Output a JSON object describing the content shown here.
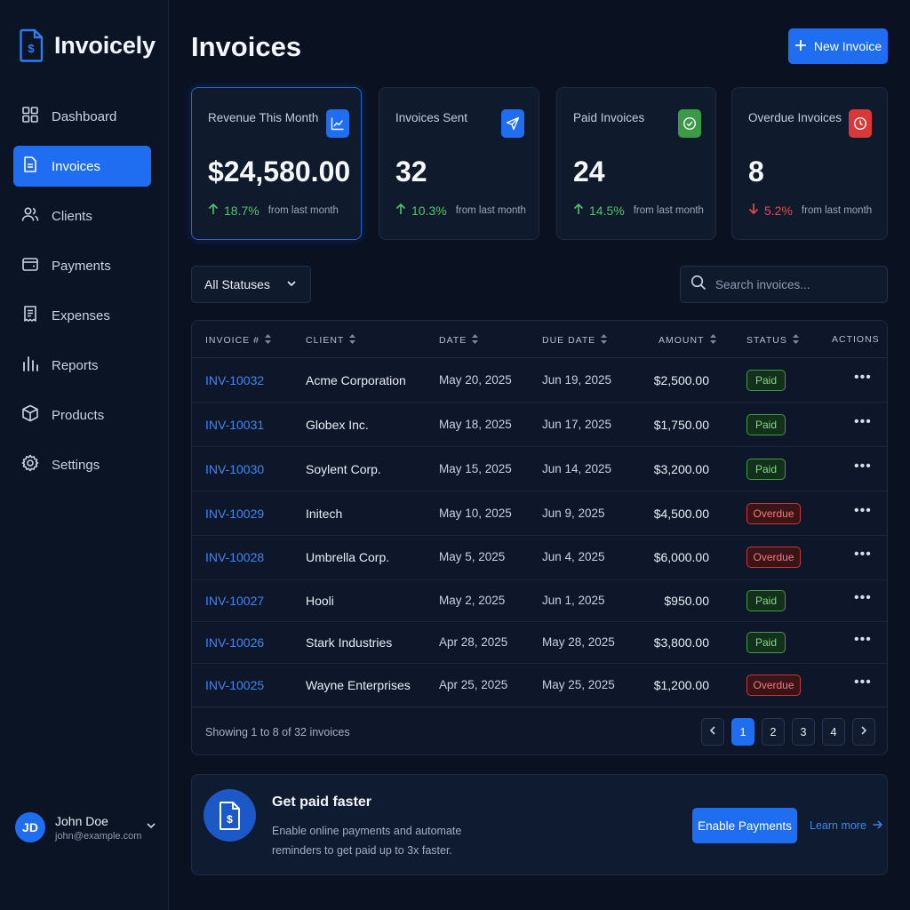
{
  "brand": {
    "name": "Invoicely"
  },
  "nav": [
    {
      "label": "Dashboard",
      "icon": "grid-icon"
    },
    {
      "label": "Invoices",
      "icon": "document-icon",
      "active": true
    },
    {
      "label": "Clients",
      "icon": "users-icon"
    },
    {
      "label": "Payments",
      "icon": "wallet-icon"
    },
    {
      "label": "Expenses",
      "icon": "receipt-icon"
    },
    {
      "label": "Reports",
      "icon": "bar-chart-icon"
    },
    {
      "label": "Products",
      "icon": "box-icon"
    },
    {
      "label": "Settings",
      "icon": "gear-icon"
    }
  ],
  "user": {
    "initials": "JD",
    "name": "John Doe",
    "email": "john@example.com"
  },
  "header": {
    "title": "Invoices",
    "new_invoice_label": "New Invoice"
  },
  "stats": [
    {
      "label": "Revenue This Month",
      "value": "$24,580.00",
      "trend": "18.7%",
      "direction": "up",
      "from": "from last month",
      "icon": "trend-chart-icon",
      "icon_color": "#1f6df0"
    },
    {
      "label": "Invoices Sent",
      "value": "32",
      "trend": "10.3%",
      "direction": "up",
      "from": "from last month",
      "icon": "send-icon",
      "icon_color": "#1f6df0"
    },
    {
      "label": "Paid Invoices",
      "value": "24",
      "trend": "14.5%",
      "direction": "up",
      "from": "from last month",
      "icon": "check-circle-icon",
      "icon_color": "#3a9a46"
    },
    {
      "label": "Overdue Invoices",
      "value": "8",
      "trend": "5.2%",
      "direction": "down",
      "from": "from last month",
      "icon": "clock-icon",
      "icon_color": "#d93838"
    }
  ],
  "filters": {
    "status_selected": "All Statuses",
    "search_placeholder": "Search invoices..."
  },
  "table": {
    "columns": [
      "INVOICE #",
      "CLIENT",
      "DATE",
      "DUE DATE",
      "AMOUNT",
      "STATUS",
      "ACTIONS"
    ],
    "rows": [
      {
        "invoice": "INV-10032",
        "client": "Acme Corporation",
        "date": "May 20, 2025",
        "due": "Jun 19, 2025",
        "amount": "$2,500.00",
        "status": "Paid"
      },
      {
        "invoice": "INV-10031",
        "client": "Globex Inc.",
        "date": "May 18, 2025",
        "due": "Jun 17, 2025",
        "amount": "$1,750.00",
        "status": "Paid"
      },
      {
        "invoice": "INV-10030",
        "client": "Soylent Corp.",
        "date": "May 15, 2025",
        "due": "Jun 14, 2025",
        "amount": "$3,200.00",
        "status": "Paid"
      },
      {
        "invoice": "INV-10029",
        "client": "Initech",
        "date": "May 10, 2025",
        "due": "Jun 9, 2025",
        "amount": "$4,500.00",
        "status": "Overdue"
      },
      {
        "invoice": "INV-10028",
        "client": "Umbrella Corp.",
        "date": "May 5, 2025",
        "due": "Jun 4, 2025",
        "amount": "$6,000.00",
        "status": "Overdue"
      },
      {
        "invoice": "INV-10027",
        "client": "Hooli",
        "date": "May 2, 2025",
        "due": "Jun 1, 2025",
        "amount": "$950.00",
        "status": "Paid"
      },
      {
        "invoice": "INV-10026",
        "client": "Stark Industries",
        "date": "Apr 28, 2025",
        "due": "May 28, 2025",
        "amount": "$3,800.00",
        "status": "Paid"
      },
      {
        "invoice": "INV-10025",
        "client": "Wayne Enterprises",
        "date": "Apr 25, 2025",
        "due": "May 25, 2025",
        "amount": "$1,200.00",
        "status": "Overdue"
      }
    ],
    "showing_text": "Showing 1 to 8 of 32 invoices",
    "pages": [
      "1",
      "2",
      "3",
      "4"
    ],
    "current_page": "1"
  },
  "promo": {
    "title": "Get paid faster",
    "description": "Enable online payments and automate reminders to get paid up to 3x faster.",
    "enable_label": "Enable Payments",
    "learn_more_label": "Learn more"
  },
  "colors": {
    "accent": "#1f6df0",
    "paid": "#3f9b47",
    "overdue": "#c33a3a",
    "background": "#0a1222"
  }
}
